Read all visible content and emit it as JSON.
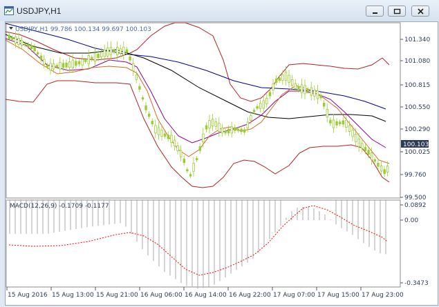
{
  "window": {
    "title": "USDJPY,H1",
    "buttons": [
      "minimize",
      "maximize",
      "close"
    ]
  },
  "colors": {
    "candle": "#9acd32",
    "bollinger": "#b22222",
    "ma_fast": "#d2691e",
    "ma_mid": "#8b008b",
    "ma_black": "#000000",
    "ma_blue": "#00008b",
    "macd_signal": "#ff0000",
    "macd_hist": "#a9a9a9",
    "axis_text": "#2b3a55",
    "price_tag": "#2b3a55"
  },
  "main_chart": {
    "legend": "USDJPY,H1 99.786 100.134 99.697 100.103",
    "current_price": "100.103",
    "y_ticks": [
      "101.340",
      "101.080",
      "100.815",
      "100.550",
      "100.290",
      "100.025",
      "99.760",
      "99.500"
    ]
  },
  "macd": {
    "label": "MACD(12,26,9) -0.1709 -0.1177",
    "y_ticks": [
      "0.0892",
      "0.00",
      "-0.3473"
    ]
  },
  "x_ticks": [
    "15 Aug 2016",
    "15 Aug 13:00",
    "15 Aug 21:00",
    "16 Aug 06:00",
    "16 Aug 14:00",
    "16 Aug 22:00",
    "17 Aug 07:00",
    "17 Aug 15:00",
    "17 Aug 23:00"
  ]
}
